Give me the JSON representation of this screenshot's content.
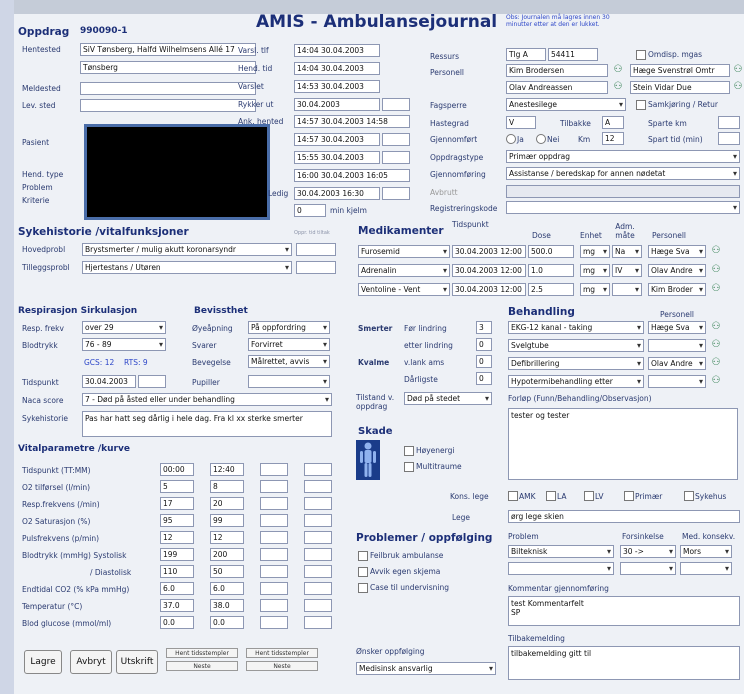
{
  "title": "AMIS - Ambulansejournal",
  "note": "Obs: Journalen må lagres innen 30 minutter etter at den er lukket.",
  "oppdrag": {
    "label": "Oppdrag",
    "number": "990090-1",
    "hentested_label": "Hentested",
    "hentested": "SiV Tønsberg, Halfd Wilhelmsens Allé 17",
    "hentested2": "Tønsberg",
    "meldested_label": "Meldested",
    "levsted_label": "Lev. sted",
    "pasient_label": "Pasient",
    "hendtype_label": "Hend. type",
    "problem_label": "Problem",
    "kriterie_label": "Kriterie"
  },
  "times": {
    "items": [
      {
        "label": "Varsl. tlf",
        "value": "14:04 30.04.2003"
      },
      {
        "label": "Hend. tid",
        "value": "14:04 30.04.2003"
      },
      {
        "label": "Varslet",
        "value": "14:53 30.04.2003"
      },
      {
        "label": "Rykker ut",
        "value": "30.04.2003"
      },
      {
        "label": "Ank. hented",
        "value": "14:57 30.04.2003 14:58"
      },
      {
        "label": "",
        "value": "14:57 30.04.2003"
      },
      {
        "label": "",
        "value": "15:55 30.04.2003"
      },
      {
        "label": "",
        "value": "16:00 30.04.2003 16:05"
      },
      {
        "label": "Ledig",
        "value": "30.04.2003 16:30"
      }
    ],
    "ambulanse_value": "0",
    "matkjelm_label": "min kjelm"
  },
  "ressurs": {
    "ressurs_label": "Ressurs",
    "ressurs_value": "Tlg A",
    "ressurs_code": "54411",
    "omdisp_label": "Omdisp. mgas",
    "personell_label": "Personell",
    "personell": [
      "Kim Brodersen",
      "Hæge Svenstrøl Omtr",
      "Olav Andreassen",
      "Stein Vidar Due"
    ],
    "fagsperre_label": "Fagsperre",
    "fagsperre_value": "Anestesilege",
    "samkjort_label": "Samkjøring / Retur",
    "hastegrad_label": "Hastegrad",
    "hastegrad_value": "V",
    "tilbakke_label": "Tilbakke",
    "tilbakke_value": "A",
    "sparte_km_label": "Sparte km",
    "gjennomfort_label": "Gjennomført",
    "ja_label": "Ja",
    "nei_label": "Nei",
    "km_label": "Km",
    "km_value": "12",
    "sparte_tid_label": "Spart tid (min)",
    "oppdragstype_label": "Oppdragstype",
    "oppdragstype_value": "Primær oppdrag",
    "gjennomforing_label": "Gjennomføring",
    "gjennomforing_value": "Assistanse / beredskap for annen nødetat",
    "avbrutt_label": "Avbrutt",
    "registreringskode_label": "Registreringskode"
  },
  "sykehistorie": {
    "title": "Sykehistorie /vitalfunksjoner",
    "hovedprob_label": "Hovedprobl",
    "hovedprob_value": "Brystsmerter / mulig akutt koronarsyndr",
    "tilleggsprob_label": "Tilleggsprobl",
    "tilleggsprob_value": "Hjertestans / Utøren",
    "time_hint": "Oppr. tid tiltak"
  },
  "medikamenter": {
    "title": "Medikamenter",
    "headers": [
      "Tidspunkt",
      "Dose",
      "Enhet",
      "Adm. måte",
      "Personell"
    ],
    "rows": [
      {
        "name": "Furosemid",
        "time": "30.04.2003 12:00",
        "dose": "500.0",
        "unit": "mg",
        "route": "Na",
        "person": "Hæge Sva"
      },
      {
        "name": "Adrenalin",
        "time": "30.04.2003 12:00",
        "dose": "1.0",
        "unit": "mg",
        "route": "IV",
        "person": "Olav Andre"
      },
      {
        "name": "Ventoline - Vent",
        "time": "30.04.2003 12:00",
        "dose": "2.5",
        "unit": "mg",
        "route": "",
        "person": "Kim Broder"
      }
    ]
  },
  "respirasjon": {
    "title": "Respirasjon Sirkulasjon",
    "resp_label": "Resp. frekv",
    "resp_value": "over 29",
    "blodtrykk_label": "Blodtrykk",
    "blodtrykk_value": "76 - 89",
    "gcs": "GCS: 12",
    "rts": "RTS: 9",
    "tidspunkt_label": "Tidspunkt",
    "tidspunkt_value": "30.04.2003",
    "naca_label": "Naca score",
    "naca_value": "7 - Død på åsted eller under behandling",
    "sykehistorie_label": "Sykehistorie",
    "sykehistorie_value": "Pas har hatt seg dårlig i hele dag. Fra kl xx sterke smerter"
  },
  "bevissthet": {
    "title": "Bevissthet",
    "oyeapning_label": "Øyeåpning",
    "oyeapning_value": "På oppfordring",
    "svarer_label": "Svarer",
    "svarer_value": "Forvirret",
    "bevegelse_label": "Bevegelse",
    "bevegelse_value": "Målrettet, avvis",
    "pupiller_label": "Pupiller"
  },
  "smerter": {
    "smerter_label": "Smerter",
    "ferlindring_label": "Før lindring",
    "ferlindring_value": "3",
    "etter_label": "etter lindring",
    "etter_value": "0",
    "kvalme_label": "Kvalme",
    "vlank_label": "v.lank ams",
    "vlank_value": "0",
    "darlig_label": "Dårligste",
    "darlig_value": "0",
    "tilstand_label": "Tilstand v. oppdrag",
    "tilstand_value": "Død på stedet",
    "skade_label": "Skade",
    "hoyenergi_label": "Høyenergi",
    "multitraume_label": "Multitraume"
  },
  "behandling": {
    "title": "Behandling",
    "personell_label": "Personell",
    "rows": [
      {
        "name": "EKG-12 kanal - taking",
        "person": "Hæge Sva"
      },
      {
        "name": "Svelgtube",
        "person": ""
      },
      {
        "name": "Defibrillering",
        "person": "Olav Andre"
      },
      {
        "name": "Hypotermibehandling etter",
        "person": ""
      }
    ],
    "forlop_label": "Forløp (Funn/Behandling/Observasjon)",
    "forlop_value": "tester og tester"
  },
  "vitalparametre": {
    "title": "Vitalparametre /kurve",
    "rows": [
      {
        "label": "Tidspunkt (TT:MM)",
        "v1": "00:00",
        "v2": "12:40"
      },
      {
        "label": "O2 tilførsel (l/min)",
        "v1": "5",
        "v2": "8"
      },
      {
        "label": "Resp.frekvens (/min)",
        "v1": "17",
        "v2": "20"
      },
      {
        "label": "O2 Saturasjon (%)",
        "v1": "95",
        "v2": "99"
      },
      {
        "label": "Pulsfrekvens (p/min)",
        "v1": "12",
        "v2": "12"
      },
      {
        "label": "Blodtrykk (mmHg)   Systolisk",
        "v1": "199",
        "v2": "200"
      },
      {
        "label": "/ Diastolisk",
        "v1": "110",
        "v2": "50"
      },
      {
        "label": "Endtidal CO2 (% kPa mmHg)",
        "v1": "6.0",
        "v2": "6.0"
      },
      {
        "label": "Temperatur (°C)",
        "v1": "37.0",
        "v2": "38.0"
      },
      {
        "label": "Blod glucose (mmol/ml)",
        "v1": "0.0",
        "v2": "0.0"
      }
    ]
  },
  "konsulent": {
    "kons_label": "Kons. lege",
    "options": [
      "AMK",
      "LA",
      "LV",
      "Primær",
      "Sykehus"
    ],
    "lege_label": "Lege",
    "lege_value": "ørg lege skien"
  },
  "problemer": {
    "title": "Problemer / oppfølging",
    "items": [
      "Feilbruk ambulanse",
      "Avvik egen skjema",
      "Case til undervisning"
    ],
    "problem_label": "Problem",
    "forsinkelse_label": "Forsinkelse",
    "med_label": "Med. konsekv.",
    "problem_value": "Bilteknisk",
    "forsinkelse_value": "30 ->",
    "med_value": "Mors"
  },
  "kommentar": {
    "label": "Kommentar gjennomføring",
    "value": "test Kommentarfelt\nSP",
    "tilbake_label": "Tilbakemelding",
    "tilbake_value": "tilbakemelding gitt til"
  },
  "onsker": {
    "label": "Ønsker oppfølging",
    "value": "Medisinsk ansvarlig"
  },
  "buttons": {
    "lagre": "Lagre",
    "avbryt": "Avbryt",
    "utskrift": "Utskrift",
    "mini": [
      "Hent tidsstempler",
      "Neste",
      "Hent tidsstempler",
      "Neste"
    ]
  }
}
